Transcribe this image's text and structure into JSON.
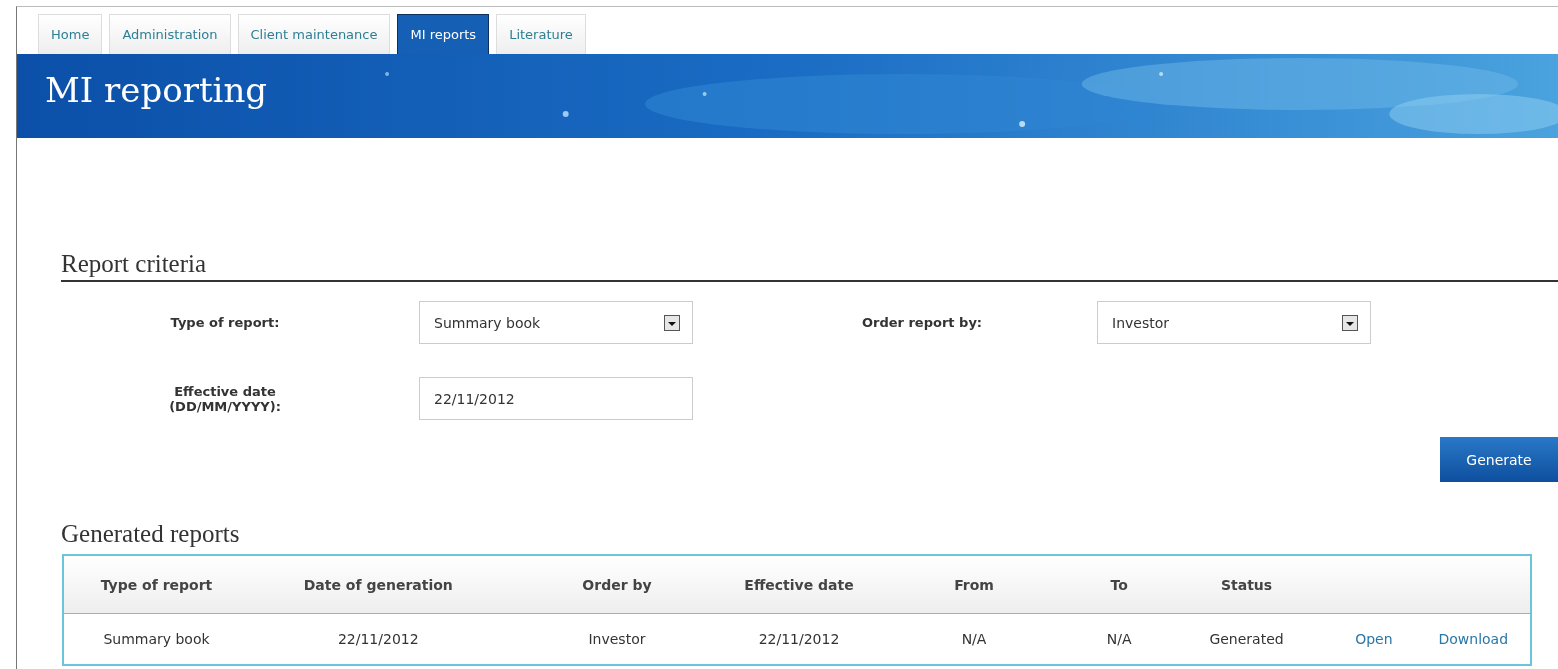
{
  "tabs": [
    {
      "label": "Home",
      "selected": false
    },
    {
      "label": "Administration",
      "selected": false
    },
    {
      "label": "Client maintenance",
      "selected": false
    },
    {
      "label": "MI reports",
      "selected": true
    },
    {
      "label": "Literature",
      "selected": false
    }
  ],
  "banner": {
    "title": "MI reporting"
  },
  "report_criteria": {
    "title": "Report criteria",
    "fields": [
      {
        "label": "Type of report:",
        "kind": "select",
        "value": "Summary book"
      },
      {
        "label": "Order report by:",
        "kind": "select",
        "value": "Investor"
      },
      {
        "label": "Effective date\n(DD/MM/YYYY):",
        "kind": "input",
        "value": "22/11/2012"
      }
    ],
    "generate_button": "Generate"
  },
  "generated_reports": {
    "title": "Generated reports",
    "columns": [
      "Type of report",
      "Date of generation",
      "Order by",
      "Effective date",
      "From",
      "To",
      "Status",
      "",
      ""
    ],
    "rows": [
      {
        "cells": [
          "Summary book",
          "22/11/2012",
          "Investor",
          "22/11/2012",
          "N/A",
          "N/A",
          "Generated"
        ],
        "actions": [
          "Open",
          "Download"
        ]
      }
    ]
  }
}
